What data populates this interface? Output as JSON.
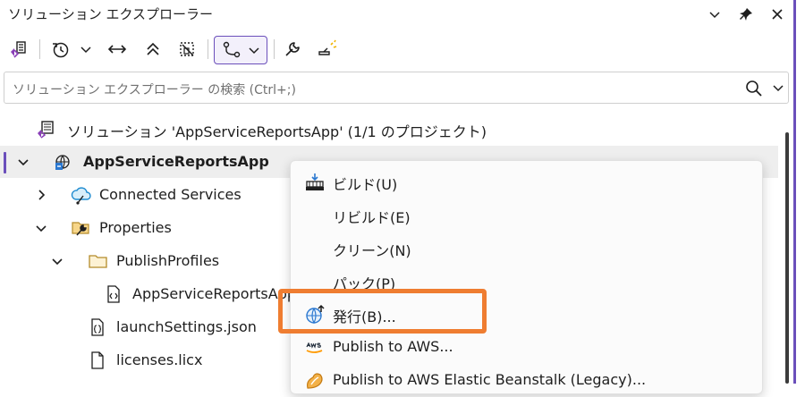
{
  "window": {
    "title": "ソリューション エクスプローラー"
  },
  "search": {
    "placeholder": "ソリューション エクスプローラー の検索 (Ctrl+;)"
  },
  "tree": {
    "solution_label": "ソリューション 'AppServiceReportsApp' (1/1 のプロジェクト)",
    "project_label": "AppServiceReportsApp",
    "connected_services_label": "Connected Services",
    "properties_label": "Properties",
    "publish_profiles_label": "PublishProfiles",
    "pubxml_label": "AppServiceReportsApp",
    "launch_settings_label": "launchSettings.json",
    "licenses_label": "licenses.licx"
  },
  "context_menu": {
    "items": [
      {
        "label": "ビルド(U)",
        "icon": "build-icon"
      },
      {
        "label": "リビルド(E)",
        "icon": ""
      },
      {
        "label": "クリーン(N)",
        "icon": ""
      },
      {
        "label": "パック(P)",
        "icon": ""
      },
      {
        "label": "発行(B)...",
        "icon": "publish-globe-icon"
      },
      {
        "label": "Publish to AWS...",
        "icon": "aws-icon"
      },
      {
        "label": "Publish to AWS Elastic Beanstalk (Legacy)...",
        "icon": "beanstalk-icon"
      }
    ]
  },
  "colors": {
    "accent": "#6b4fbb",
    "highlight": "#ef7d31",
    "selection": "#eeeeee"
  }
}
